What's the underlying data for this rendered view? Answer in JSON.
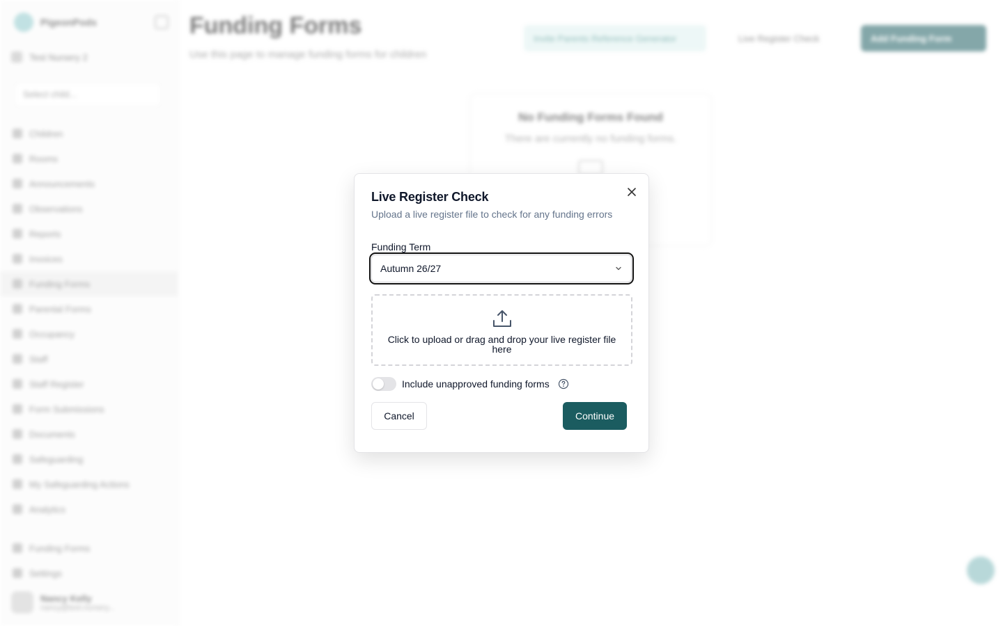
{
  "background": {
    "sidebar": {
      "logo_text": "PigeonPods",
      "school_name": "Test Nursery 2",
      "child_select_placeholder": "Select child...",
      "nav_items": [
        {
          "label": "Children",
          "icon": "users-icon"
        },
        {
          "label": "Rooms",
          "icon": "grid-icon"
        },
        {
          "label": "Announcements",
          "icon": "megaphone-icon"
        },
        {
          "label": "Observations",
          "icon": "eye-icon"
        },
        {
          "label": "Reports",
          "icon": "chart-icon"
        },
        {
          "label": "Invoices",
          "icon": "receipt-icon"
        },
        {
          "label": "Funding Forms",
          "icon": "file-icon"
        },
        {
          "label": "Parental Forms",
          "icon": "clipboard-icon"
        },
        {
          "label": "Occupancy",
          "icon": "calendar-icon"
        },
        {
          "label": "Staff",
          "icon": "user-icon"
        },
        {
          "label": "Staff Register",
          "icon": "list-icon"
        },
        {
          "label": "Form Submissions",
          "icon": "inbox-icon"
        },
        {
          "label": "Documents",
          "icon": "folder-icon"
        },
        {
          "label": "Safeguarding",
          "icon": "shield-icon"
        },
        {
          "label": "My Safeguarding Actions",
          "icon": "check-icon"
        },
        {
          "label": "Analytics",
          "icon": "analytics-icon"
        }
      ],
      "bottom_items": [
        {
          "label": "Funding Forms",
          "icon": "file-icon"
        },
        {
          "label": "Settings",
          "icon": "gear-icon"
        }
      ],
      "user": {
        "name": "Nancy Kelly",
        "email": "nancy@test-nursery..."
      }
    },
    "header": {
      "title": "Funding Forms",
      "subtitle": "Use this page to manage funding forms for children",
      "btn_primary_soft": "Invite Parents Reference Generator",
      "btn_live_register": "Live Register Check",
      "btn_add": "Add Funding Form"
    },
    "empty_state": {
      "title": "No Funding Forms Found",
      "subtitle": "There are currently no funding forms."
    }
  },
  "dialog": {
    "title": "Live Register Check",
    "description": "Upload a live register file to check for any funding errors",
    "funding_term_label": "Funding Term",
    "funding_term_value": "Autumn 26/27",
    "upload_text": "Click to upload or drag and drop your live register file here",
    "toggle_label": "Include unapproved funding forms",
    "toggle_on": false,
    "cancel_label": "Cancel",
    "continue_label": "Continue"
  },
  "colors": {
    "primary": "#1b5c60",
    "border": "#e4e4e7",
    "muted_text": "#64748b"
  }
}
